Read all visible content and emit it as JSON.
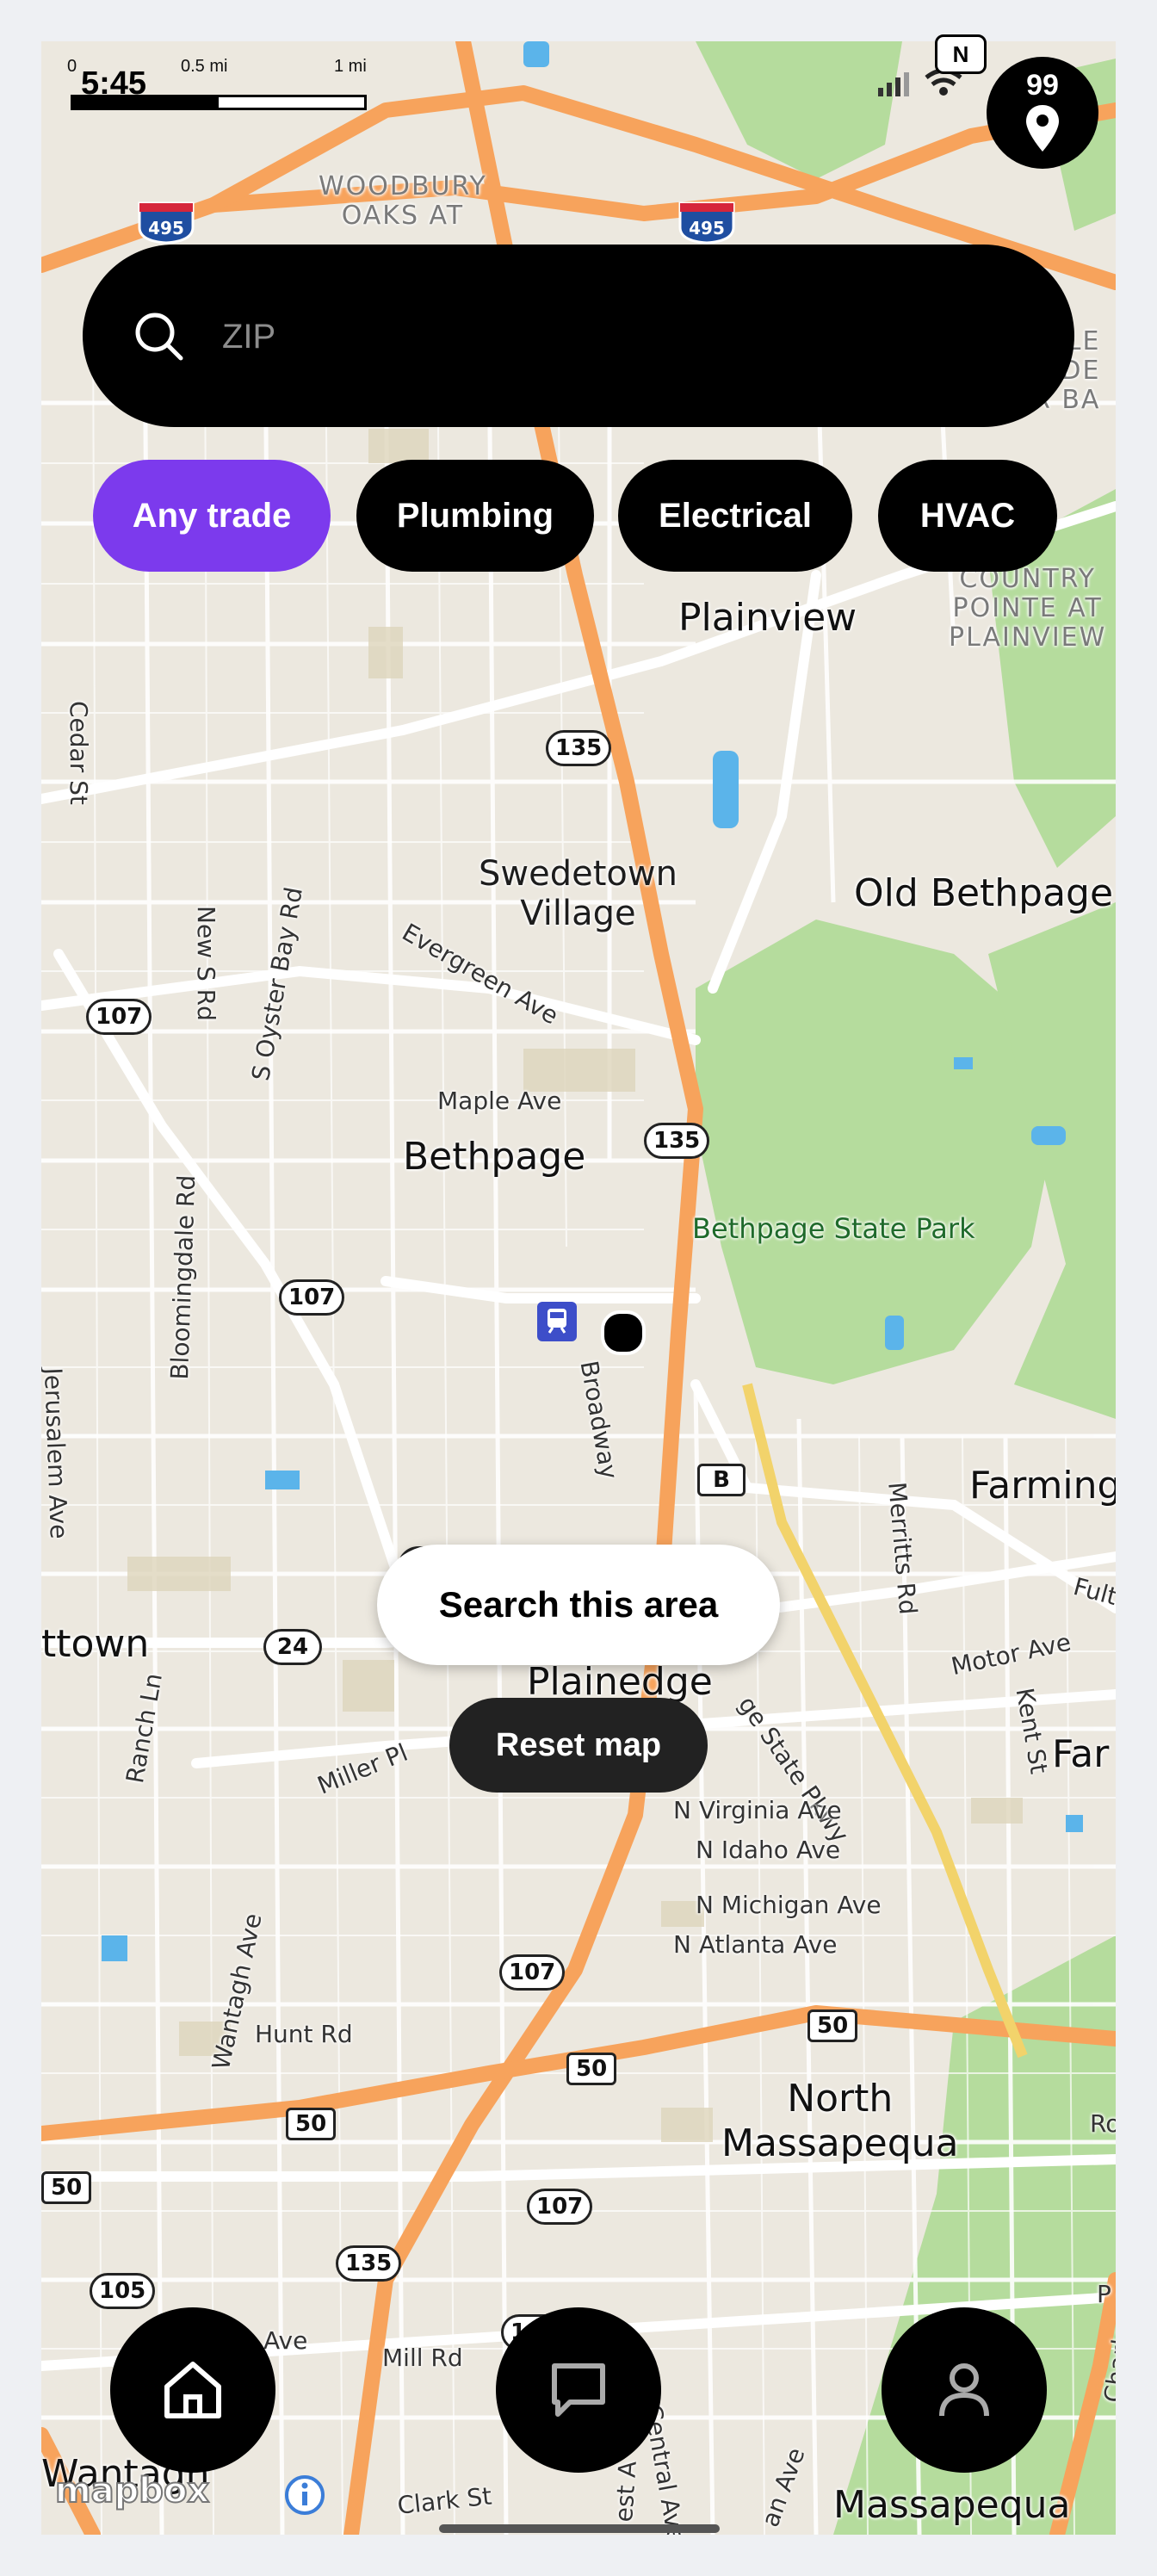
{
  "status_bar": {
    "time": "5:45",
    "scale_labels": [
      "0",
      "0.5 mi",
      "1 mi"
    ]
  },
  "locate_button": {
    "count": "99"
  },
  "search": {
    "placeholder": "ZIP",
    "value": ""
  },
  "filters": [
    {
      "label": "Any trade",
      "active": true
    },
    {
      "label": "Plumbing",
      "active": false
    },
    {
      "label": "Electrical",
      "active": false
    },
    {
      "label": "HVAC",
      "active": false
    }
  ],
  "map": {
    "places": {
      "plainview": "Plainview",
      "swedetown": "Swedetown\nVillage",
      "old_bethpage": "Old Bethpage",
      "bethpage": "Bethpage",
      "farming": "Farming",
      "far": "Far",
      "ttown": "ttown",
      "plainedge": "Plainedge",
      "north_massapequa": "North\nMassapequa",
      "wantagh": "Wantagh",
      "massapequa": "Massapequa"
    },
    "areas": {
      "woodbury": "WOODBURY\nOAKS AT",
      "country_pointe": "COUNTRY\nPOINTE AT\nPLAINVIEW",
      "right_edge": "LE\nDE\nER BA"
    },
    "park": "Bethpage State Park",
    "streets": {
      "cedar": "Cedar St",
      "new_s": "New S Rd",
      "s_oyster": "S Oyster Bay Rd",
      "evergreen": "Evergreen Ave",
      "maple": "Maple Ave",
      "broadway": "Broadway",
      "bloomingdale": "Bloomingdale Rd",
      "jerusalem": "Jerusalem Ave",
      "merritts": "Merritts Rd",
      "fulton": "Fulto",
      "motor": "Motor Ave",
      "kent": "Kent St",
      "ranch": "Ranch Ln",
      "miller": "Miller Pl",
      "bethpage_pkwy": "ge State Pkwy",
      "n_virginia": "N Virginia Ave",
      "n_idaho": "N Idaho Ave",
      "n_michigan": "N Michigan Ave",
      "n_atlanta": "N Atlanta Ave",
      "wantagh_ave": "Wantagh Ave",
      "hunt": "Hunt Rd",
      "mill": "Mill Rd",
      "ave": "Ave",
      "clark": "Clark St",
      "central": "Central Ave",
      "charles": "Charles Av",
      "rd_edge": "Ro",
      "p_edge": "P",
      "west_a": "est A",
      "an_ave": "an Ave"
    },
    "shields": {
      "i495": "495",
      "r135": "135",
      "r107": "107",
      "r24": "24",
      "rB": "B",
      "r105": "105",
      "r50": "50"
    }
  },
  "actions": {
    "search_area": "Search this area",
    "reset_map": "Reset map"
  },
  "attribution": {
    "logo": "mapbox"
  },
  "nav": [
    {
      "name": "home",
      "icon": "home-icon"
    },
    {
      "name": "messages",
      "icon": "chat-icon"
    },
    {
      "name": "profile",
      "icon": "user-icon"
    }
  ],
  "colors": {
    "accent": "#7c3aed",
    "highway": "#f7a35c",
    "park": "#b5dc9d",
    "water": "#5bb4ea",
    "land": "#ece8df"
  }
}
